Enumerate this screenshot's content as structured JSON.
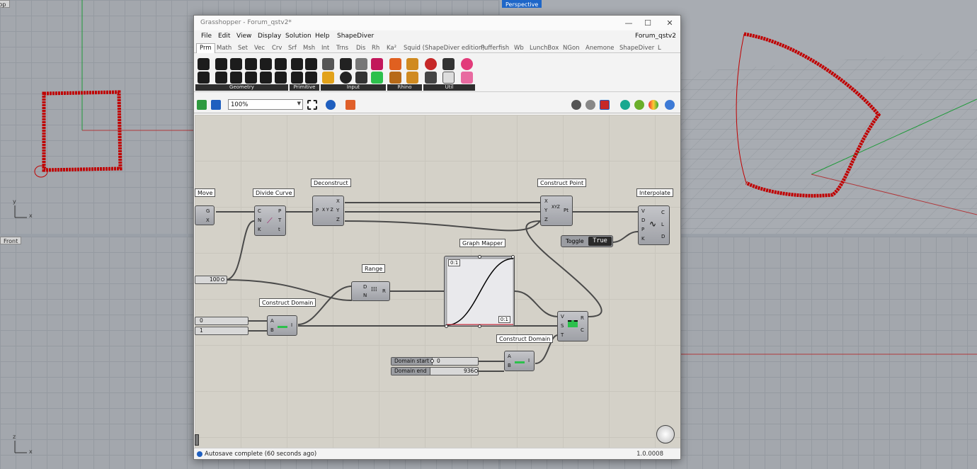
{
  "viewports": {
    "top": {
      "label": "Top"
    },
    "perspective": {
      "label": "Perspective"
    },
    "front": {
      "label": "Front"
    },
    "axis": {
      "x": "x",
      "y": "y",
      "z": "z"
    }
  },
  "window": {
    "title": "Grasshopper - Forum_qstv2*",
    "document_name": "Forum_qstv2",
    "controls": {
      "minimize": "—",
      "maximize": "☐",
      "close": "✕"
    }
  },
  "menu": [
    "File",
    "Edit",
    "View",
    "Display",
    "Solution",
    "Help",
    "ShapeDiver"
  ],
  "tabs": [
    "Prm",
    "Math",
    "Set",
    "Vec",
    "Crv",
    "Srf",
    "Msh",
    "Int",
    "Trns",
    "Dis",
    "Rh",
    "Ka²",
    "Squid (ShapeDiver edition)",
    "Pufferfish",
    "Wb",
    "LunchBox",
    "NGon",
    "Anemone",
    "ShapeDiver",
    "L"
  ],
  "ribbon_groups": [
    "Geometry",
    "Primitive",
    "Input",
    "Rhino",
    "Util"
  ],
  "toolbar": {
    "zoom": "100%"
  },
  "components": {
    "move": {
      "name": "Move",
      "outputs": [
        "G",
        "X"
      ]
    },
    "divide_curve": {
      "name": "Divide Curve",
      "inputs": [
        "C",
        "N",
        "K"
      ],
      "outputs": [
        "P",
        "T",
        "t"
      ]
    },
    "deconstruct": {
      "name": "Deconstruct",
      "inputs": [
        "P"
      ],
      "outputs": [
        "X",
        "Y",
        "Z"
      ]
    },
    "construct_point": {
      "name": "Construct Point",
      "inputs": [
        "X",
        "Y",
        "Z"
      ],
      "outputs": [
        "Pt"
      ]
    },
    "interpolate": {
      "name": "Interpolate",
      "inputs": [
        "V",
        "D",
        "P",
        "K"
      ],
      "outputs": [
        "C",
        "L",
        "D"
      ]
    },
    "toggle": {
      "name": "Toggle",
      "value": "True"
    },
    "graph_mapper": {
      "name": "Graph Mapper",
      "top_label": "0:1",
      "bottom_label": "0:1"
    },
    "range": {
      "name": "Range",
      "inputs": [
        "D",
        "N"
      ],
      "outputs": [
        "R"
      ]
    },
    "construct_domain_1": {
      "name": "Construct Domain",
      "inputs": [
        "A",
        "B"
      ],
      "outputs": [
        "I"
      ]
    },
    "construct_domain_2": {
      "name": "Construct Domain",
      "inputs": [
        "A",
        "B"
      ],
      "outputs": [
        "I"
      ]
    },
    "remap": {
      "inputs": [
        "V",
        "S",
        "T"
      ],
      "outputs": [
        "R",
        "C"
      ]
    }
  },
  "sliders": {
    "count": {
      "value": "100"
    },
    "a": {
      "value": "0"
    },
    "b": {
      "value": "1"
    },
    "domain_start": {
      "name": "Domain start",
      "value": "0"
    },
    "domain_end": {
      "name": "Domain end",
      "value": "936"
    }
  },
  "status": {
    "message": "Autosave complete (60 seconds ago)",
    "version": "1.0.0008"
  },
  "colors": {
    "curve": "#c00000",
    "canvas": "#d4d1c8",
    "wire": "#4a4a4a"
  }
}
